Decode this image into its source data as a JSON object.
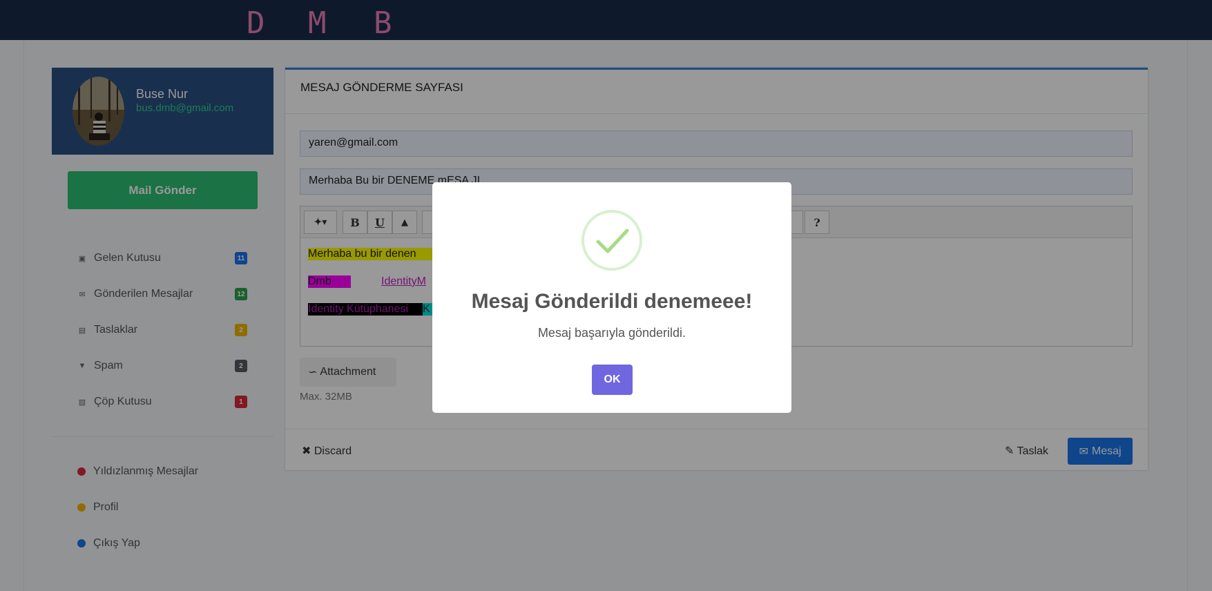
{
  "brand": {
    "letters": [
      "D",
      "M",
      "B"
    ]
  },
  "user": {
    "name": "Buse Nur",
    "email": "bus.dmb@gmail.com"
  },
  "sidebar": {
    "compose_label": "Mail Gönder",
    "folders": [
      {
        "label": "Gelen Kutusu",
        "count": "11",
        "color": "#1a73e8",
        "icon": "inbox-icon"
      },
      {
        "label": "Gönderilen Mesajlar",
        "count": "12",
        "color": "#2e9e4e",
        "icon": "envelope-icon"
      },
      {
        "label": "Taslaklar",
        "count": "2",
        "color": "#f0b400",
        "icon": "file-icon"
      },
      {
        "label": "Spam",
        "count": "2",
        "color": "#555b61",
        "icon": "filter-icon"
      },
      {
        "label": "Çöp Kutusu",
        "count": "1",
        "color": "#d92b3a",
        "icon": "trash-icon"
      }
    ],
    "links": [
      {
        "label": "Yıldızlanmış Mesajlar",
        "color": "#d92b3a"
      },
      {
        "label": "Profil",
        "color": "#f0b400"
      },
      {
        "label": "Çıkış Yap",
        "color": "#1a73e8"
      }
    ]
  },
  "compose": {
    "title": "MESAJ GÖNDERME SAYFASI",
    "to": "yaren@gmail.com",
    "subject": "Merhaba Bu bir DENEME mESA JI",
    "editor_lines": [
      "Merhaba bu bir denen",
      "Dmb",
      "IdentityM",
      "Identity Kütüphanesi",
      "K"
    ],
    "attachment_label": "Attachment",
    "max_size": "Max. 32MB",
    "discard_label": "Discard",
    "draft_label": "Taslak",
    "send_label": "Mesaj",
    "help_label": "?"
  },
  "modal": {
    "title": "Mesaj Gönderildi denemeee!",
    "text": "Mesaj başarıyla gönderildi.",
    "ok_label": "OK"
  }
}
